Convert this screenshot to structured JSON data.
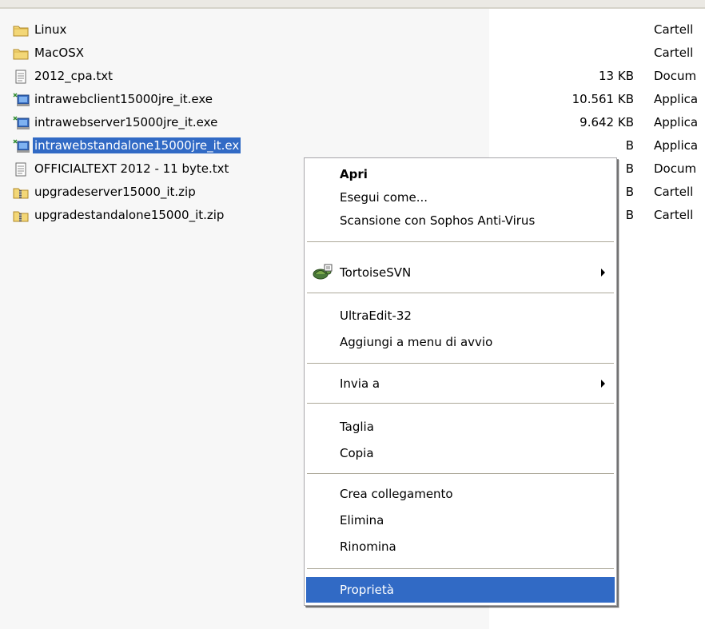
{
  "files": [
    {
      "name": "Linux",
      "size": "",
      "type": "Cartell",
      "icon": "folder-icon",
      "selected": false
    },
    {
      "name": "MacOSX",
      "size": "",
      "type": "Cartell",
      "icon": "folder-icon",
      "selected": false
    },
    {
      "name": "2012_cpa.txt",
      "size": "13 KB",
      "type": "Docum",
      "icon": "text-file-icon",
      "selected": false
    },
    {
      "name": "intrawebclient15000jre_it.exe",
      "size": "10.561 KB",
      "type": "Applica",
      "icon": "installer-icon",
      "selected": false
    },
    {
      "name": "intrawebserver15000jre_it.exe",
      "size": "9.642 KB",
      "type": "Applica",
      "icon": "installer-icon",
      "selected": false
    },
    {
      "name": "intrawebstandalone15000jre_it.ex",
      "size": "B",
      "type": "Applica",
      "icon": "installer-icon",
      "selected": true
    },
    {
      "name": "OFFICIALTEXT 2012 - 11 byte.txt",
      "size": "B",
      "type": "Docum",
      "icon": "text-file-icon",
      "selected": false
    },
    {
      "name": "upgradeserver15000_it.zip",
      "size": "B",
      "type": "Cartell",
      "icon": "zip-folder-icon",
      "selected": false
    },
    {
      "name": "upgradestandalone15000_it.zip",
      "size": "B",
      "type": "Cartell",
      "icon": "zip-folder-icon",
      "selected": false
    }
  ],
  "context_menu": {
    "open": "Apri",
    "run_as": "Esegui come...",
    "scan": "Scansione con Sophos Anti-Virus",
    "tortoise": "TortoiseSVN",
    "ultraedit": "UltraEdit-32",
    "add_startup": "Aggiungi a menu di avvio",
    "send_to": "Invia a",
    "cut": "Taglia",
    "copy": "Copia",
    "create_shortcut": "Crea collegamento",
    "delete": "Elimina",
    "rename": "Rinomina",
    "properties": "Proprietà"
  },
  "colors": {
    "selection": "#316ac5",
    "name_column_bg": "#f7f7f7",
    "folder": "#f3d777"
  }
}
